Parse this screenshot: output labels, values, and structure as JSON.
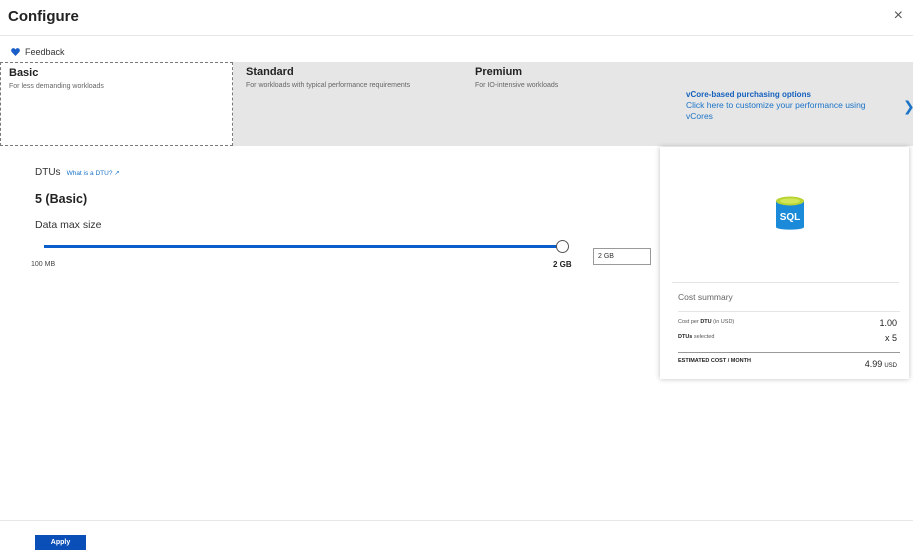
{
  "header": {
    "title": "Configure",
    "close_icon": "close-icon",
    "close_glyph": "×"
  },
  "feedback": {
    "label": "Feedback",
    "icon": "heart-icon",
    "color": "#1a5dc9"
  },
  "tiers": [
    {
      "name": "Basic",
      "description": "For less demanding workloads",
      "selected": true
    },
    {
      "name": "Standard",
      "description": "For workloads with typical performance requirements",
      "selected": false
    },
    {
      "name": "Premium",
      "description": "For IO-intensive workloads",
      "selected": false
    }
  ],
  "vcore": {
    "title": "vCore-based purchasing options",
    "description": "Click here to customize your performance using vCores",
    "icon": "chevron-right-icon",
    "chevron_glyph": "❯"
  },
  "dtu": {
    "label": "DTUs",
    "help_link": "What is a DTU? ↗",
    "value": "5 (Basic)"
  },
  "data_max_size": {
    "label": "Data max size",
    "min_label": "100 MB",
    "max_label": "2 GB",
    "slider_fraction": 1.0,
    "input_value": "2 GB"
  },
  "cost_summary": {
    "sql_icon_label": "SQL",
    "title": "Cost summary",
    "rows": [
      {
        "label_bold": "",
        "label_pre": "Cost per ",
        "label_mid": "DTU",
        "label_post": " (in USD)",
        "value": "1.00"
      },
      {
        "label_pre": "",
        "label_mid": "DTUs",
        "label_post": " selected",
        "value": "x 5"
      }
    ],
    "estimated_label": "ESTIMATED COST / MONTH",
    "estimated_value": "4.99",
    "estimated_unit": "USD"
  },
  "footer": {
    "apply_label": "Apply"
  },
  "colors": {
    "accent": "#0a5ec9",
    "link": "#1a73c7",
    "tier_bg": "#e6e6e6",
    "apply_bg": "#0a4fb8"
  }
}
